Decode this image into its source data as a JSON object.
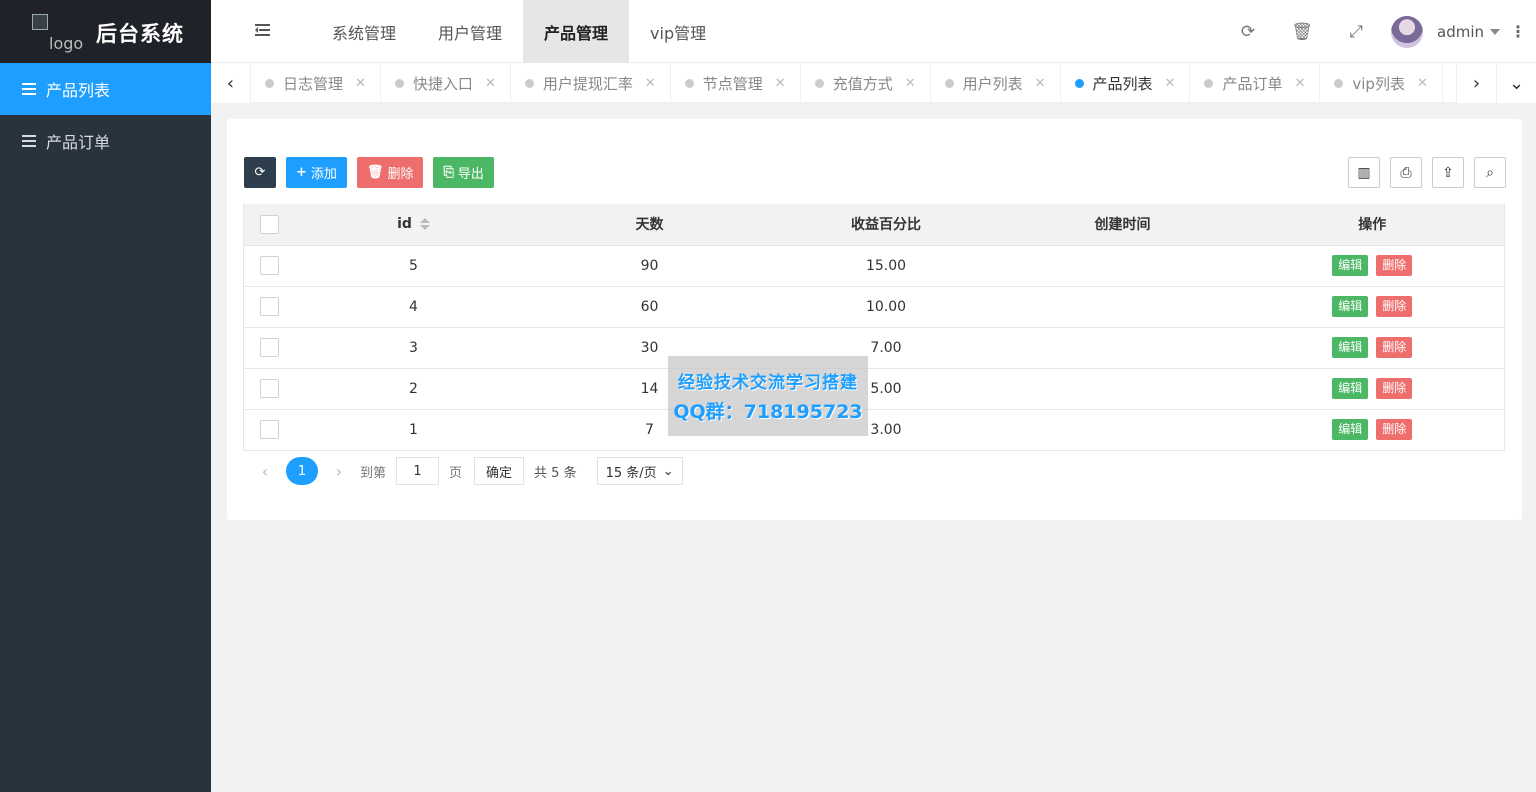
{
  "sidebar": {
    "logo_alt": "logo",
    "brand": "后台系统",
    "items": [
      {
        "label": "产品列表",
        "active": true
      },
      {
        "label": "产品订单",
        "active": false
      }
    ]
  },
  "header": {
    "tabs": [
      {
        "label": "系统管理",
        "active": false
      },
      {
        "label": "用户管理",
        "active": false
      },
      {
        "label": "产品管理",
        "active": true
      },
      {
        "label": "vip管理",
        "active": false
      }
    ],
    "user_name": "admin",
    "icons": [
      "refresh-icon",
      "trash-icon",
      "fullscreen-icon",
      "more-icon"
    ]
  },
  "page_tabs": [
    {
      "label": "日志管理",
      "active": false
    },
    {
      "label": "快捷入口",
      "active": false
    },
    {
      "label": "用户提现汇率",
      "active": false
    },
    {
      "label": "节点管理",
      "active": false
    },
    {
      "label": "充值方式",
      "active": false
    },
    {
      "label": "用户列表",
      "active": false
    },
    {
      "label": "产品列表",
      "active": true
    },
    {
      "label": "产品订单",
      "active": false
    },
    {
      "label": "vip列表",
      "active": false
    }
  ],
  "toolbar": {
    "add_label": "添加",
    "delete_label": "删除",
    "export_label": "导出"
  },
  "table": {
    "columns": [
      "id",
      "天数",
      "收益百分比",
      "创建时间",
      "操作"
    ],
    "rows": [
      {
        "id": "5",
        "days": "90",
        "rate": "15.00",
        "created": ""
      },
      {
        "id": "4",
        "days": "60",
        "rate": "10.00",
        "created": ""
      },
      {
        "id": "3",
        "days": "30",
        "rate": "7.00",
        "created": ""
      },
      {
        "id": "2",
        "days": "14",
        "rate": "5.00",
        "created": ""
      },
      {
        "id": "1",
        "days": "7",
        "rate": "3.00",
        "created": ""
      }
    ],
    "edit_label": "编辑",
    "delete_label": "删除"
  },
  "pager": {
    "current": "1",
    "goto_prefix": "到第",
    "goto_value": "1",
    "goto_suffix": "页",
    "confirm": "确定",
    "total": "共 5 条",
    "per_page": "15 条/页"
  },
  "watermark": {
    "line1": "经验技术交流学习搭建",
    "line2": "QQ群：718195723"
  },
  "colors": {
    "accent": "#1e9fff",
    "sidebar_bg": "#28333e",
    "success": "#4cb865",
    "danger": "#ee6e6e"
  }
}
